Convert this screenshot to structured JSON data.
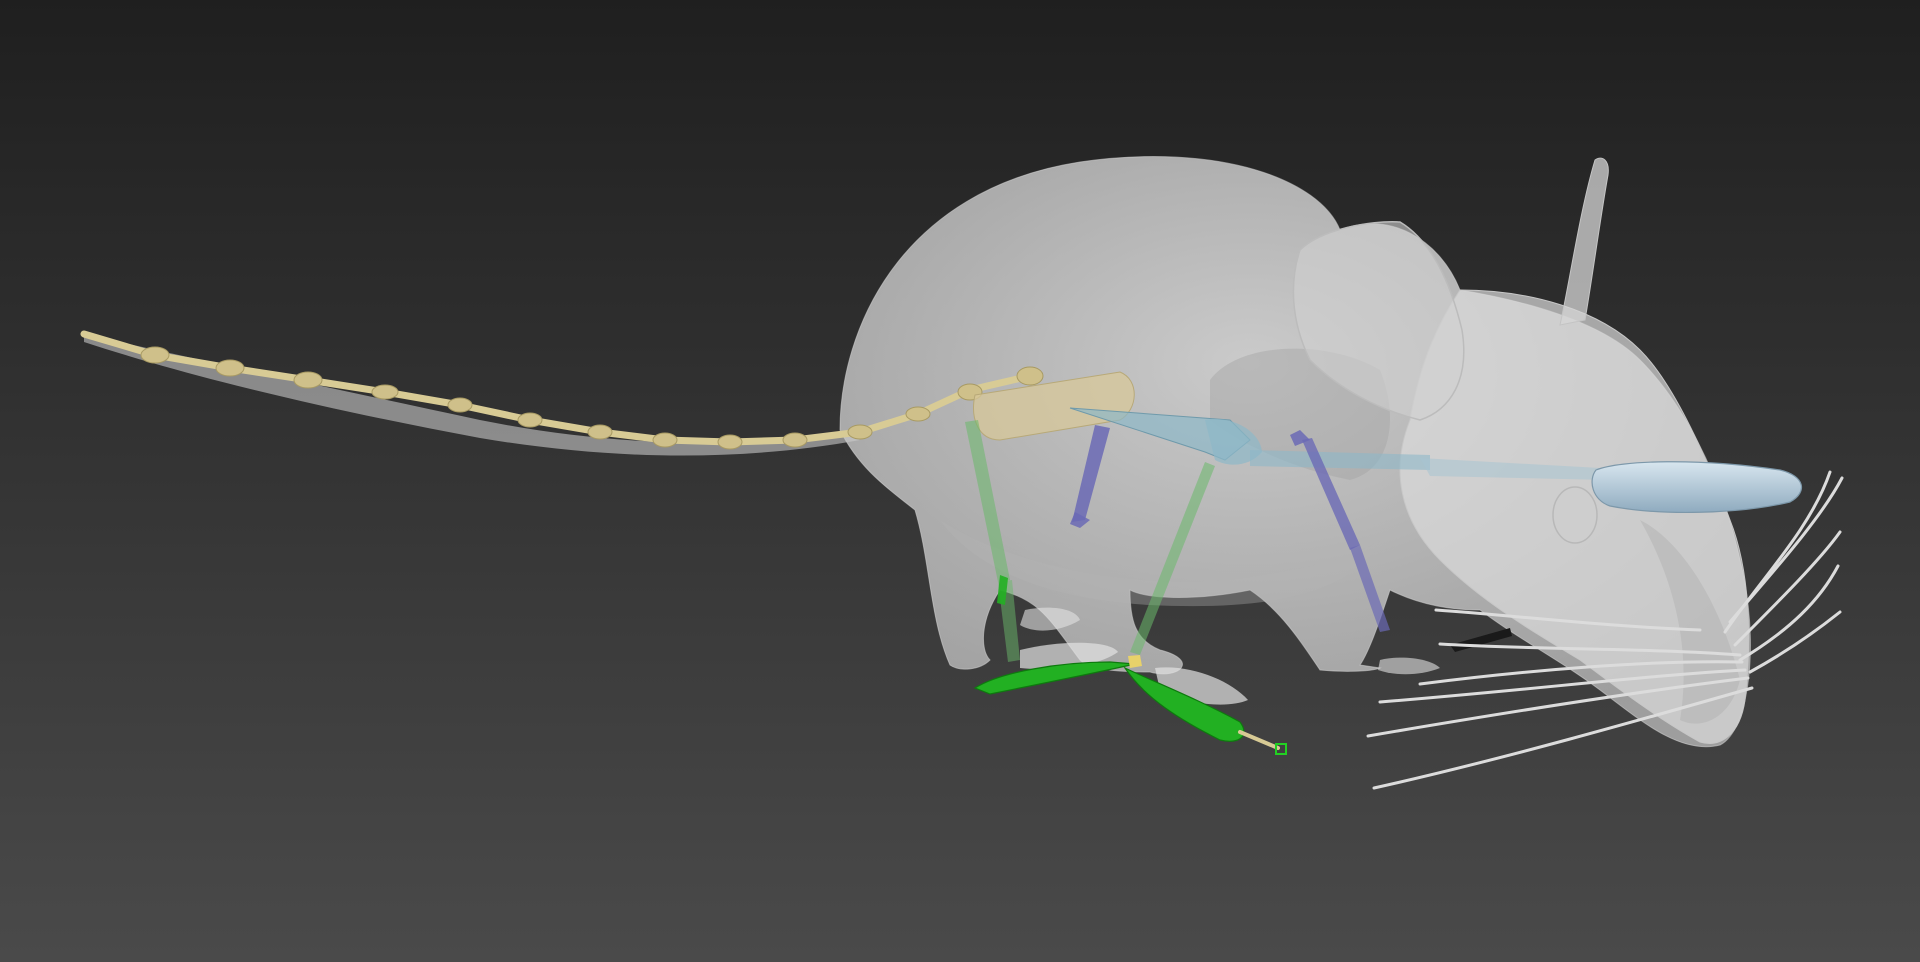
{
  "viewport": {
    "scene": "rigged-rat-3d-model",
    "background_gradient": [
      "#1f1f1f",
      "#4a4a4a"
    ],
    "colors": {
      "body_skin": "#d9d9d9",
      "tail_spine_bones": "#d8cb95",
      "pelvis_bone": "#d8c89a",
      "spine_bones_blue": "#8db8c8",
      "head_bone": "#b8cede",
      "front_leg_bones": "#6b6ab5",
      "hind_leg_bones": "#6ab86a",
      "selected_foot_controls": "#22b022",
      "foot_control_outline": "#0e7a0e",
      "whiskers": "#dcdcdc",
      "jaw_bone": "#1a1a1a"
    },
    "icons": {
      "model": "rat-mesh-icon",
      "selection": "selected-bone-icon"
    }
  }
}
